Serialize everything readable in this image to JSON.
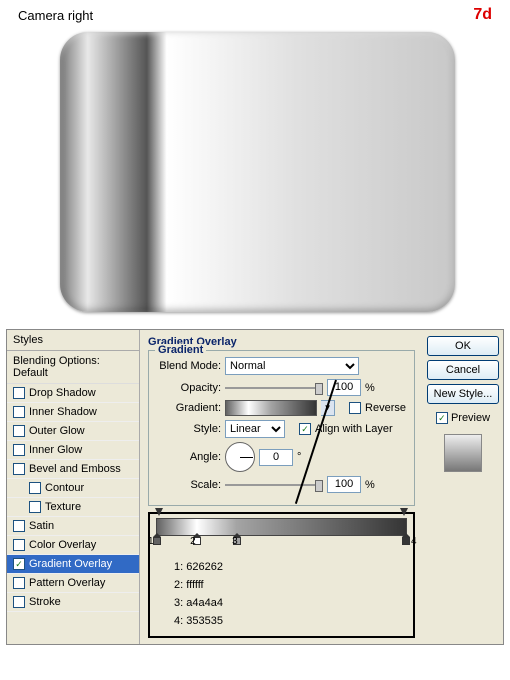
{
  "header": {
    "title": "Camera right",
    "step": "7d"
  },
  "styles": {
    "heading": "Styles",
    "blending_default": "Blending Options: Default",
    "items": [
      {
        "label": "Drop Shadow",
        "checked": false,
        "selected": false
      },
      {
        "label": "Inner Shadow",
        "checked": false,
        "selected": false
      },
      {
        "label": "Outer Glow",
        "checked": false,
        "selected": false
      },
      {
        "label": "Inner Glow",
        "checked": false,
        "selected": false
      },
      {
        "label": "Bevel and Emboss",
        "checked": false,
        "selected": false
      },
      {
        "label": "Contour",
        "checked": false,
        "selected": false,
        "sub": true
      },
      {
        "label": "Texture",
        "checked": false,
        "selected": false,
        "sub": true
      },
      {
        "label": "Satin",
        "checked": false,
        "selected": false
      },
      {
        "label": "Color Overlay",
        "checked": false,
        "selected": false
      },
      {
        "label": "Gradient Overlay",
        "checked": true,
        "selected": true
      },
      {
        "label": "Pattern Overlay",
        "checked": false,
        "selected": false
      },
      {
        "label": "Stroke",
        "checked": false,
        "selected": false
      }
    ]
  },
  "gradient_overlay": {
    "title": "Gradient Overlay",
    "group": "Gradient",
    "blend_mode_label": "Blend Mode:",
    "blend_mode": "Normal",
    "opacity_label": "Opacity:",
    "opacity": "100",
    "opacity_unit": "%",
    "gradient_label": "Gradient:",
    "reverse_label": "Reverse",
    "reverse_checked": false,
    "style_label": "Style:",
    "style": "Linear",
    "align_label": "Align with Layer",
    "align_checked": true,
    "angle_label": "Angle:",
    "angle": "0",
    "angle_unit": "°",
    "scale_label": "Scale:",
    "scale": "100",
    "scale_unit": "%"
  },
  "gradient_editor": {
    "stops": [
      {
        "n": "1",
        "pos": 0,
        "color": "626262"
      },
      {
        "n": "2",
        "pos": 16,
        "color": "ffffff"
      },
      {
        "n": "3",
        "pos": 32,
        "color": "a4a4a4"
      },
      {
        "n": "4",
        "pos": 100,
        "color": "353535"
      }
    ],
    "list": [
      "1: 626262",
      "2: ffffff",
      "3: a4a4a4",
      "4: 353535"
    ]
  },
  "buttons": {
    "ok": "OK",
    "cancel": "Cancel",
    "new_style": "New Style...",
    "preview": "Preview"
  }
}
